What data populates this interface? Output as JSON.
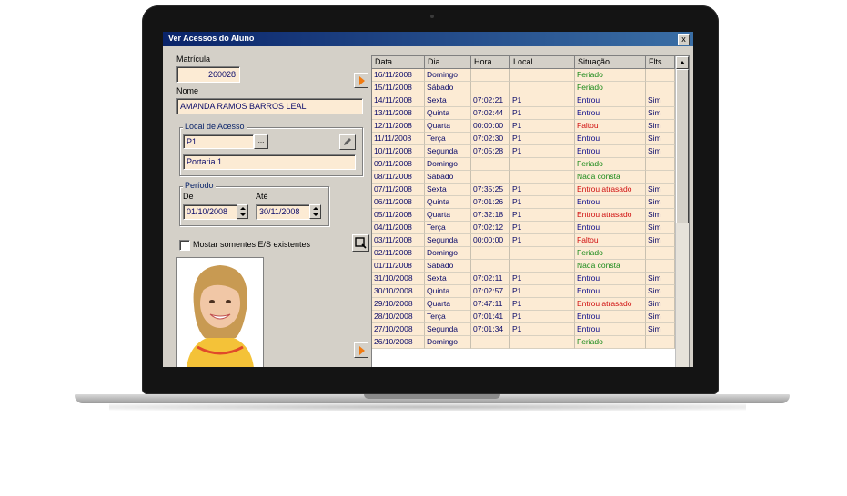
{
  "window": {
    "title": "Ver Acessos do Aluno",
    "close_label": "x"
  },
  "form": {
    "matricula_label": "Matrícula",
    "matricula_value": "260028",
    "nome_label": "Nome",
    "nome_value": "AMANDA RAMOS BARROS LEAL",
    "local_group_label": "Local de Acesso",
    "local_code": "P1",
    "local_browse": "...",
    "local_name": "Portaria 1",
    "periodo_group_label": "Período",
    "de_label": "De",
    "de_value": "01/10/2008",
    "ate_label": "Até",
    "ate_value": "30/11/2008",
    "checkbox_label": "Mostar somentes E/S existentes"
  },
  "colors": {
    "entrou": "#0a0a8a",
    "feriado": "#1a8a1a",
    "nada": "#1a8a1a",
    "faltou": "#d01010",
    "atrasado": "#d01010"
  },
  "table": {
    "columns": [
      "Data",
      "Dia",
      "Hora",
      "Local",
      "Situação",
      "Flts"
    ],
    "rows": [
      {
        "data": "16/11/2008",
        "dia": "Domingo",
        "hora": "",
        "local": "",
        "situacao": "Feriado",
        "flts": "",
        "status": "feriado"
      },
      {
        "data": "15/11/2008",
        "dia": "Sábado",
        "hora": "",
        "local": "",
        "situacao": "Feriado",
        "flts": "",
        "status": "feriado"
      },
      {
        "data": "14/11/2008",
        "dia": "Sexta",
        "hora": "07:02:21",
        "local": "P1",
        "situacao": "Entrou",
        "flts": "Sim",
        "status": "entrou"
      },
      {
        "data": "13/11/2008",
        "dia": "Quinta",
        "hora": "07:02:44",
        "local": "P1",
        "situacao": "Entrou",
        "flts": "Sim",
        "status": "entrou"
      },
      {
        "data": "12/11/2008",
        "dia": "Quarta",
        "hora": "00:00:00",
        "local": "P1",
        "situacao": "Faltou",
        "flts": "Sim",
        "status": "faltou"
      },
      {
        "data": "11/11/2008",
        "dia": "Terça",
        "hora": "07:02:30",
        "local": "P1",
        "situacao": "Entrou",
        "flts": "Sim",
        "status": "entrou"
      },
      {
        "data": "10/11/2008",
        "dia": "Segunda",
        "hora": "07:05:28",
        "local": "P1",
        "situacao": "Entrou",
        "flts": "Sim",
        "status": "entrou"
      },
      {
        "data": "09/11/2008",
        "dia": "Domingo",
        "hora": "",
        "local": "",
        "situacao": "Feriado",
        "flts": "",
        "status": "feriado"
      },
      {
        "data": "08/11/2008",
        "dia": "Sábado",
        "hora": "",
        "local": "",
        "situacao": "Nada consta",
        "flts": "",
        "status": "nada"
      },
      {
        "data": "07/11/2008",
        "dia": "Sexta",
        "hora": "07:35:25",
        "local": "P1",
        "situacao": "Entrou atrasado",
        "flts": "Sim",
        "status": "atrasado"
      },
      {
        "data": "06/11/2008",
        "dia": "Quinta",
        "hora": "07:01:26",
        "local": "P1",
        "situacao": "Entrou",
        "flts": "Sim",
        "status": "entrou"
      },
      {
        "data": "05/11/2008",
        "dia": "Quarta",
        "hora": "07:32:18",
        "local": "P1",
        "situacao": "Entrou atrasado",
        "flts": "Sim",
        "status": "atrasado"
      },
      {
        "data": "04/11/2008",
        "dia": "Terça",
        "hora": "07:02:12",
        "local": "P1",
        "situacao": "Entrou",
        "flts": "Sim",
        "status": "entrou"
      },
      {
        "data": "03/11/2008",
        "dia": "Segunda",
        "hora": "00:00:00",
        "local": "P1",
        "situacao": "Faltou",
        "flts": "Sim",
        "status": "faltou"
      },
      {
        "data": "02/11/2008",
        "dia": "Domingo",
        "hora": "",
        "local": "",
        "situacao": "Feriado",
        "flts": "",
        "status": "feriado"
      },
      {
        "data": "01/11/2008",
        "dia": "Sábado",
        "hora": "",
        "local": "",
        "situacao": "Nada consta",
        "flts": "",
        "status": "nada"
      },
      {
        "data": "31/10/2008",
        "dia": "Sexta",
        "hora": "07:02:11",
        "local": "P1",
        "situacao": "Entrou",
        "flts": "Sim",
        "status": "entrou"
      },
      {
        "data": "30/10/2008",
        "dia": "Quinta",
        "hora": "07:02:57",
        "local": "P1",
        "situacao": "Entrou",
        "flts": "Sim",
        "status": "entrou"
      },
      {
        "data": "29/10/2008",
        "dia": "Quarta",
        "hora": "07:47:11",
        "local": "P1",
        "situacao": "Entrou atrasado",
        "flts": "Sim",
        "status": "atrasado"
      },
      {
        "data": "28/10/2008",
        "dia": "Terça",
        "hora": "07:01:41",
        "local": "P1",
        "situacao": "Entrou",
        "flts": "Sim",
        "status": "entrou"
      },
      {
        "data": "27/10/2008",
        "dia": "Segunda",
        "hora": "07:01:34",
        "local": "P1",
        "situacao": "Entrou",
        "flts": "Sim",
        "status": "entrou"
      },
      {
        "data": "26/10/2008",
        "dia": "Domingo",
        "hora": "",
        "local": "",
        "situacao": "Feriado",
        "flts": "",
        "status": "feriado"
      }
    ]
  }
}
